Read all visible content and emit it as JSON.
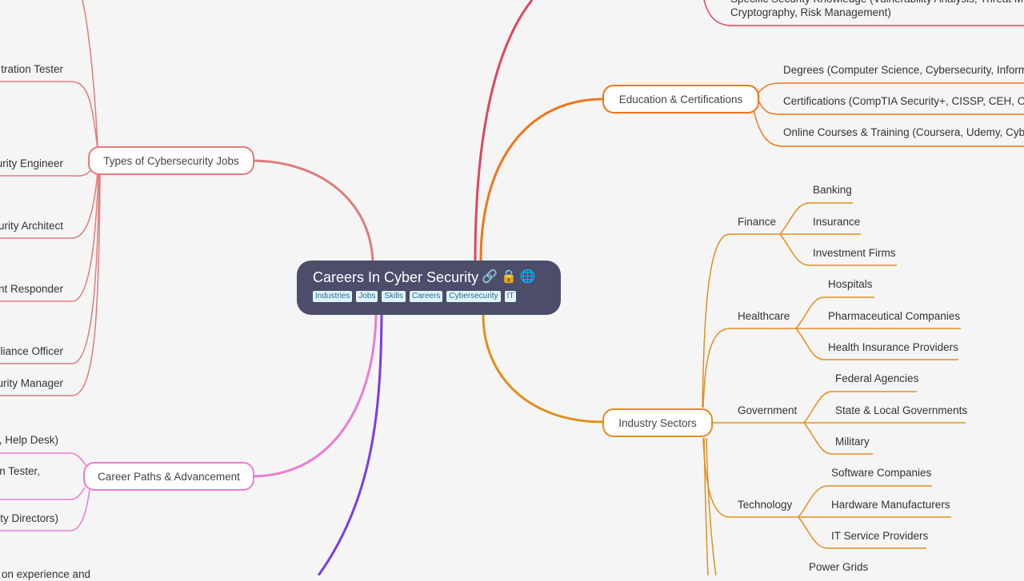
{
  "root": {
    "title": "Careers In Cyber Security",
    "icons": [
      "link-icon",
      "lock-icon",
      "globe-icon"
    ],
    "icon_glyphs": {
      "link": "🔗",
      "lock": "🔒",
      "globe": "🌐"
    },
    "tags": [
      "Industries",
      "Jobs",
      "Skills",
      "Careers",
      "Cybersecurity",
      "IT"
    ]
  },
  "colors": {
    "types_of_jobs": "#e07c7c",
    "career_paths": "#ec7cd0",
    "purple_branch": "#7c3aed",
    "skills_branch": "#e0455e",
    "education": "#f57417",
    "industry": "#e28f1e",
    "root_bg": "#4b4d6b",
    "tag_bg": "#dff3fb"
  },
  "branches": {
    "types_of_jobs": {
      "label": "Types of Cybersecurity Jobs",
      "children": [
        "tration Tester",
        "urity Engineer",
        "urity Architect",
        "nt Responder",
        "pliance Officer",
        "urity Manager"
      ]
    },
    "career_paths": {
      "label": "Career Paths & Advancement",
      "children": [
        ", Help Desk)",
        "n Tester,",
        "ty Directors)"
      ]
    },
    "purple_branch": {
      "children": [
        "on experience and"
      ]
    },
    "skills": {
      "children": [
        "Specific Security Knowledge (Vulnerability Analysis, Threat Mo",
        "Cryptography, Risk Management)"
      ]
    },
    "education": {
      "label": "Education & Certifications",
      "children": [
        "Degrees (Computer Science, Cybersecurity, Inform",
        "Certifications (CompTIA Security+, CISSP, CEH, OSC",
        "Online Courses & Training (Coursera, Udemy, Cybra"
      ]
    },
    "industry": {
      "label": "Industry Sectors",
      "groups": [
        {
          "label": "Finance",
          "children": [
            "Banking",
            "Insurance",
            "Investment Firms"
          ]
        },
        {
          "label": "Healthcare",
          "children": [
            "Hospitals",
            "Pharmaceutical Companies",
            "Health Insurance Providers"
          ]
        },
        {
          "label": "Government",
          "children": [
            "Federal Agencies",
            "State & Local Governments",
            "Military"
          ]
        },
        {
          "label": "Technology",
          "children": [
            "Software Companies",
            "Hardware Manufacturers",
            "IT Service Providers"
          ]
        },
        {
          "label": "",
          "children": [
            "Power Grids"
          ]
        }
      ]
    }
  }
}
